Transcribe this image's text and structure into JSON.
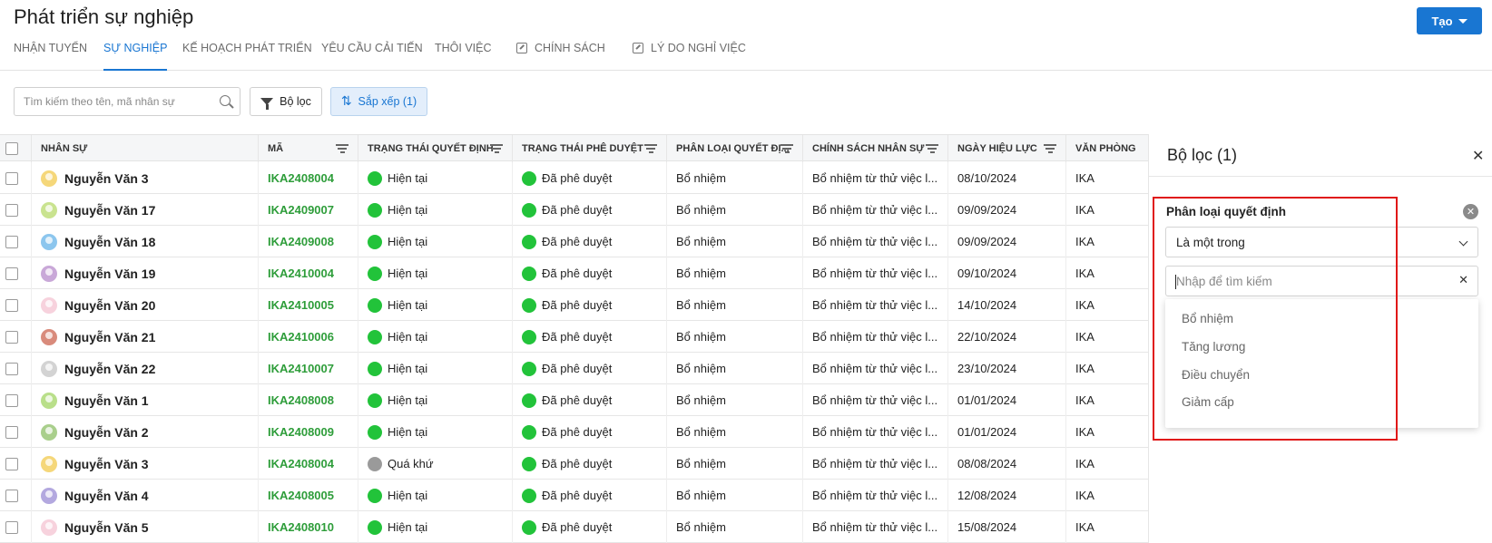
{
  "page": {
    "title": "Phát triển sự nghiệp",
    "create_label": "Tạo"
  },
  "tabs": [
    {
      "label": "NHẬN TUYỂN",
      "active": false,
      "external": false
    },
    {
      "label": "SỰ NGHIỆP",
      "active": true,
      "external": false
    },
    {
      "label": "KẾ HOẠCH PHÁT TRIỂN",
      "active": false,
      "external": false
    },
    {
      "label": "YÊU CẦU CẢI TIẾN",
      "active": false,
      "external": false
    },
    {
      "label": "THÔI VIỆC",
      "active": false,
      "external": false
    },
    {
      "label": "CHÍNH SÁCH",
      "active": false,
      "external": true
    },
    {
      "label": "LÝ DO NGHỈ VIỆC",
      "active": false,
      "external": true
    }
  ],
  "toolbar": {
    "search_placeholder": "Tìm kiếm theo tên, mã nhân sự",
    "filter_label": "Bộ lọc",
    "sort_label": "Sắp xếp (1)"
  },
  "table": {
    "columns": [
      "NHÂN SỰ",
      "MÃ",
      "TRẠNG THÁI QUYẾT ĐỊNH",
      "TRẠNG THÁI PHÊ DUYỆT",
      "PHÂN LOẠI QUYẾT ĐỊ...",
      "CHÍNH SÁCH NHÂN SỰ",
      "NGÀY HIỆU LỰC",
      "VĂN PHÒNG"
    ],
    "rows": [
      {
        "name": "Nguyễn Văn 3",
        "code": "IKA2408004",
        "decision_status": "Hiện tại",
        "approval": "Đã phê duyệt",
        "type": "Bổ nhiệm",
        "policy": "Bổ nhiệm từ thử việc l...",
        "date": "08/10/2024",
        "office": "IKA",
        "avatar_color": "#f5d77a",
        "status_color": "#22c33a"
      },
      {
        "name": "Nguyễn Văn 17",
        "code": "IKA2409007",
        "decision_status": "Hiện tại",
        "approval": "Đã phê duyệt",
        "type": "Bổ nhiệm",
        "policy": "Bổ nhiệm từ thử việc l...",
        "date": "09/09/2024",
        "office": "IKA",
        "avatar_color": "#c9e38f",
        "status_color": "#22c33a"
      },
      {
        "name": "Nguyễn Văn 18",
        "code": "IKA2409008",
        "decision_status": "Hiện tại",
        "approval": "Đã phê duyệt",
        "type": "Bổ nhiệm",
        "policy": "Bổ nhiệm từ thử việc l...",
        "date": "09/09/2024",
        "office": "IKA",
        "avatar_color": "#8cc6ee",
        "status_color": "#22c33a"
      },
      {
        "name": "Nguyễn Văn 19",
        "code": "IKA2410004",
        "decision_status": "Hiện tại",
        "approval": "Đã phê duyệt",
        "type": "Bổ nhiệm",
        "policy": "Bổ nhiệm từ thử việc l...",
        "date": "09/10/2024",
        "office": "IKA",
        "avatar_color": "#c9a8d8",
        "status_color": "#22c33a"
      },
      {
        "name": "Nguyễn Văn 20",
        "code": "IKA2410005",
        "decision_status": "Hiện tại",
        "approval": "Đã phê duyệt",
        "type": "Bổ nhiệm",
        "policy": "Bổ nhiệm từ thử việc l...",
        "date": "14/10/2024",
        "office": "IKA",
        "avatar_color": "#f7d2dd",
        "status_color": "#22c33a"
      },
      {
        "name": "Nguyễn Văn 21",
        "code": "IKA2410006",
        "decision_status": "Hiện tại",
        "approval": "Đã phê duyệt",
        "type": "Bổ nhiệm",
        "policy": "Bổ nhiệm từ thử việc l...",
        "date": "22/10/2024",
        "office": "IKA",
        "avatar_color": "#d98b7c",
        "status_color": "#22c33a"
      },
      {
        "name": "Nguyễn Văn 22",
        "code": "IKA2410007",
        "decision_status": "Hiện tại",
        "approval": "Đã phê duyệt",
        "type": "Bổ nhiệm",
        "policy": "Bổ nhiệm từ thử việc l...",
        "date": "23/10/2024",
        "office": "IKA",
        "avatar_color": "#d3d3d3",
        "status_color": "#22c33a"
      },
      {
        "name": "Nguyễn Văn 1",
        "code": "IKA2408008",
        "decision_status": "Hiện tại",
        "approval": "Đã phê duyệt",
        "type": "Bổ nhiệm",
        "policy": "Bổ nhiệm từ thử việc l...",
        "date": "01/01/2024",
        "office": "IKA",
        "avatar_color": "#b9df8a",
        "status_color": "#22c33a"
      },
      {
        "name": "Nguyễn Văn 2",
        "code": "IKA2408009",
        "decision_status": "Hiện tại",
        "approval": "Đã phê duyệt",
        "type": "Bổ nhiệm",
        "policy": "Bổ nhiệm từ thử việc l...",
        "date": "01/01/2024",
        "office": "IKA",
        "avatar_color": "#a9cf8c",
        "status_color": "#22c33a"
      },
      {
        "name": "Nguyễn Văn 3",
        "code": "IKA2408004",
        "decision_status": "Quá khứ",
        "approval": "Đã phê duyệt",
        "type": "Bổ nhiệm",
        "policy": "Bổ nhiệm từ thử việc l...",
        "date": "08/08/2024",
        "office": "IKA",
        "avatar_color": "#f5d77a",
        "status_color": "#9a9a9a"
      },
      {
        "name": "Nguyễn Văn 4",
        "code": "IKA2408005",
        "decision_status": "Hiện tại",
        "approval": "Đã phê duyệt",
        "type": "Bổ nhiệm",
        "policy": "Bổ nhiệm từ thử việc l...",
        "date": "12/08/2024",
        "office": "IKA",
        "avatar_color": "#b3a8df",
        "status_color": "#22c33a"
      },
      {
        "name": "Nguyễn Văn 5",
        "code": "IKA2408010",
        "decision_status": "Hiện tại",
        "approval": "Đã phê duyệt",
        "type": "Bổ nhiệm",
        "policy": "Bổ nhiệm từ thử việc l...",
        "date": "15/08/2024",
        "office": "IKA",
        "avatar_color": "#f7d2dd",
        "status_color": "#22c33a"
      }
    ]
  },
  "panel": {
    "title": "Bộ lọc (1)",
    "condition_label": "Phân loại quyết định",
    "operator": "Là một trong",
    "search_placeholder": "Nhập để tìm kiếm",
    "options": [
      "Bổ nhiệm",
      "Tăng lương",
      "Điều chuyển",
      "Giảm cấp"
    ]
  },
  "colors": {
    "accent": "#1976d2",
    "code_green": "#2e9d3a",
    "highlight_red": "#e01818"
  }
}
